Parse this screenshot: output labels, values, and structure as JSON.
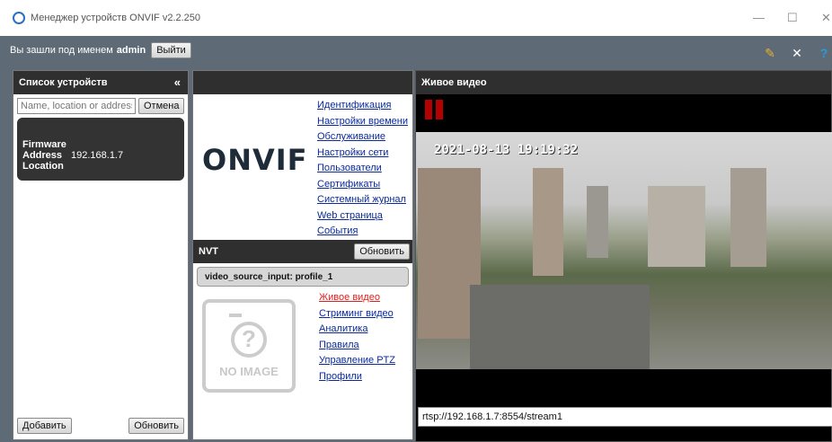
{
  "window": {
    "title": "Менеджер устройств ONVIF v2.2.250"
  },
  "login": {
    "prefix": "Вы зашли под именем",
    "user": "admin",
    "logout": "Выйти"
  },
  "devices": {
    "title": "Список устройств",
    "collapse": "«",
    "search_placeholder": "Name, location or address",
    "cancel": "Отмена",
    "card": {
      "firmware_label": "Firmware",
      "address_label": "Address",
      "address": "192.168.1.7",
      "location_label": "Location"
    },
    "add": "Добавить",
    "refresh": "Обновить"
  },
  "onvif": {
    "logo": "ONVIF",
    "links": [
      "Идентификация",
      "Настройки времени",
      "Обслуживание",
      "Настройки сети",
      "Пользователи",
      "Сертификаты",
      "Системный журнал",
      "Web страница",
      "События"
    ]
  },
  "nvt": {
    "title": "NVT",
    "refresh": "Обновить",
    "profile": "video_source_input: profile_1",
    "no_image": "NO IMAGE",
    "links": [
      "Живое видео",
      "Стриминг видео",
      "Аналитика",
      "Правила",
      "Управление PTZ",
      "Профили"
    ]
  },
  "live": {
    "title": "Живое видео",
    "timestamp": "2021-08-13 19:19:32",
    "url": "rtsp://192.168.1.7:8554/stream1"
  },
  "icons": [
    "minimize-icon",
    "maximize-icon",
    "close-icon",
    "palette-icon",
    "tools-icon",
    "help-icon",
    "pause-icon",
    "camera-placeholder-icon"
  ]
}
